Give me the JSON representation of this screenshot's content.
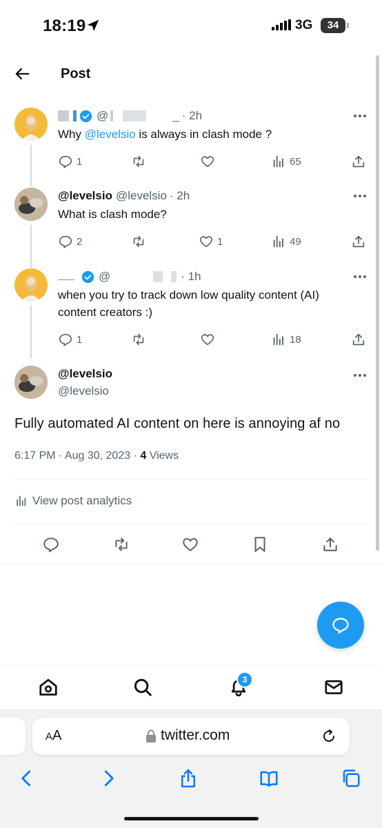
{
  "status_bar": {
    "time": "18:19",
    "network": "3G",
    "battery": "34"
  },
  "header": {
    "title": "Post"
  },
  "thread": [
    {
      "name": "",
      "handle": "@",
      "time": "· 2h",
      "text_prefix": "Why ",
      "mention": "@levelsio",
      "text_suffix": " is always in clash mode ?",
      "replies": "1",
      "retweets": "",
      "likes": "",
      "views": "65"
    },
    {
      "name": "@levelsio",
      "handle": "@levelsio",
      "time": "· 2h",
      "text": "What is clash mode?",
      "replies": "2",
      "retweets": "",
      "likes": "1",
      "views": "49"
    },
    {
      "name": "",
      "handle": "@",
      "time": "· 1h",
      "text": "when you try to track down low quality content (AI) content creators :)",
      "replies": "1",
      "retweets": "",
      "likes": "",
      "views": "18"
    }
  ],
  "main_post": {
    "name": "@levelsio",
    "handle": "@levelsio",
    "text": "Fully automated AI content on here is annoying af no",
    "timestamp": "6:17 PM · Aug 30, 2023 · ",
    "views_count": "4",
    "views_label": " Views",
    "analytics_label": "View post analytics"
  },
  "bottom_nav": {
    "notification_count": "3"
  },
  "browser": {
    "text_size_small": "A",
    "text_size_large": "A",
    "url": "twitter.com"
  },
  "colors": {
    "accent": "#1d9bf0",
    "text": "#0f1419",
    "muted": "#536471"
  }
}
